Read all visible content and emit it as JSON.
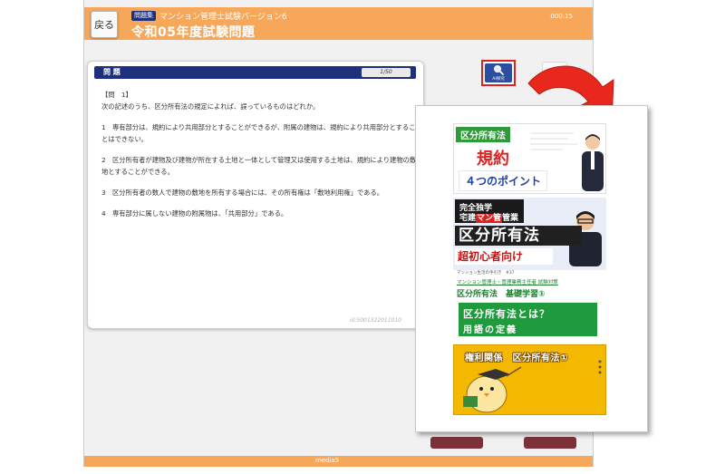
{
  "header": {
    "back_label": "戻る",
    "badge": "問題集",
    "app_name": "マンション管理士試験バージョン6",
    "exam_title": "令和05年度試験問題",
    "timer": "000:15"
  },
  "question": {
    "section_label": "問 題",
    "counter": "1/50",
    "number": "【問　1】",
    "prompt": "次の記述のうち、区分所有法の規定によれば、誤っているものはどれか。",
    "options": [
      "1　専有部分は、規約により共用部分とすることができるが、附属の建物は、規約により共用部分とすることはできない。",
      "2　区分所有者が建物及び建物が所在する土地と一体として管理又は使用する土地は、規約により建物の敷地とすることができる。",
      "3　区分所有者の数人で建物の敷地を所有する場合には、その所有権は「敷地利用権」である。",
      "4　専有部分に属しない建物の附属物は、「共用部分」である。"
    ],
    "id_text": "id:5001322011010"
  },
  "toolbar": {
    "ai_search_label": "AI探究"
  },
  "footer": {
    "brand": "media5"
  },
  "videos": [
    {
      "tag": "区分所有法",
      "title": "規約",
      "subtitle": "４つのポイント"
    },
    {
      "line1": "完全独学",
      "line2_pre": "宅建",
      "line2_mark": "マン管",
      "line2_post": "管業",
      "title": "区分所有法",
      "subtitle": "超初心者向け"
    },
    {
      "small": "マンション生活の手引き　#37",
      "series": "マンション管理士・管理業務主任者 試験対策",
      "title": "区分所有法　基礎学習①",
      "box1": "区分所有法とは？",
      "box2": "用語の定義"
    },
    {
      "title": "権利関係　区分所有法①"
    }
  ],
  "colors": {
    "header_orange": "#f7a75a",
    "navy": "#1e2f7c",
    "highlight_red": "#e02020",
    "green": "#1f9a3c",
    "yellow": "#f5b800"
  }
}
